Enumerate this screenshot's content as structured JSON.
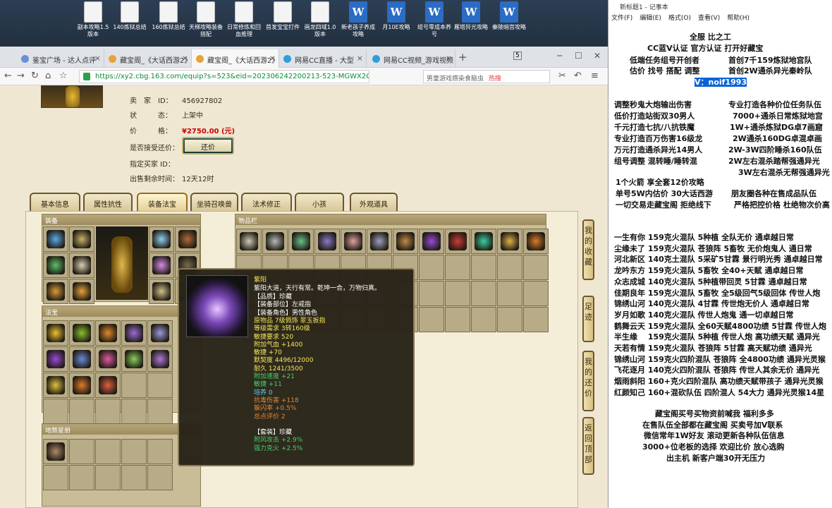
{
  "desktop": {
    "icons": [
      {
        "label": "副本攻略1.5版本",
        "type": "doc"
      },
      {
        "label": "140炼狱总结",
        "type": "doc"
      },
      {
        "label": "160炼狱总结",
        "type": "doc"
      },
      {
        "label": "天梯攻略装备搭配",
        "type": "doc"
      },
      {
        "label": "日常修炼和回血推理",
        "type": "doc"
      },
      {
        "label": "首发宝宝打件",
        "type": "doc"
      },
      {
        "label": "画龙四域1.0版本",
        "type": "doc"
      },
      {
        "label": "新老孩子养成攻略",
        "type": "word"
      },
      {
        "label": "月10E攻略",
        "type": "word"
      },
      {
        "label": "组号零成本养号",
        "type": "word"
      },
      {
        "label": "雁塔异光攻略",
        "type": "word"
      },
      {
        "label": "秦陵暗宫攻略",
        "type": "word"
      }
    ]
  },
  "browser": {
    "tabs": [
      {
        "label": "鉴宝广场 - 达人点评",
        "color": "#6a8fd8"
      },
      {
        "label": "藏宝阁_《大话西游2》",
        "color": "#e6a33a"
      },
      {
        "label": "藏宝阁_《大话西游2》",
        "color": "#e6a33a"
      },
      {
        "label": "网易CC直播 - 大型",
        "color": "#2d9ed8"
      },
      {
        "label": "网易CC视频_游戏视频",
        "color": "#2d9ed8"
      }
    ],
    "new_tab": "+",
    "tab_count": "5",
    "url": "https://xy2.cbg.163.com/equip?s=523&eid=202306242200213-523-MGWX2G7D1",
    "search_placeholder": "男童游戏感染食脑虫",
    "hot_label": "热搜",
    "nav": {
      "back": "←",
      "forward": "→",
      "refresh": "↻",
      "home": "⌂",
      "star": "☆",
      "cut": "✂",
      "undo": "↶",
      "menu": "≡",
      "minimize": "─",
      "maximize": "☐",
      "close": "✕"
    }
  },
  "listing": {
    "seller_label": "卖　家　ID：",
    "seller_id": "456927802",
    "status_label": "状　　　态：",
    "status": "上架中",
    "price_label": "价　　　格：",
    "price": "¥2750.00 (元)",
    "counter_label": "是否接受还价：",
    "counter_button": "还价",
    "buyer_label": "指定买家 ID：",
    "buyer": "",
    "remain_label": "出售剩余时间：",
    "remain": "12天12时"
  },
  "detail_tabs": [
    "基本信息",
    "属性抗性",
    "装备法宝",
    "坐骑召唤兽",
    "法术修正",
    "小孩",
    "外观道具"
  ],
  "active_tab": "装备法宝",
  "sections": {
    "equip": "装备",
    "items": "物品栏",
    "fabao": "法宝",
    "constellation": "地煞星册"
  },
  "side_buttons": [
    "我的收藏",
    "足迹",
    "我的还价",
    "返回顶部"
  ],
  "tooltip": {
    "name": "紫阳",
    "desc": "紫阳大道，天行有常。乾坤一合，万物归真。",
    "lines": [
      {
        "t": "【品质】珍藏",
        "c": "wh"
      },
      {
        "t": "【装备部位】左戒指",
        "c": "wh"
      },
      {
        "t": "【装备角色】男性角色",
        "c": "wh"
      },
      {
        "t": "原物品 7级佩饰 翠玉扳指",
        "c": "yl"
      },
      {
        "t": "等级需求 3转160级",
        "c": "yl"
      },
      {
        "t": "敏捷要求 520",
        "c": "yl"
      },
      {
        "t": "附加气血 +1400",
        "c": "yl"
      },
      {
        "t": "敏捷 +70",
        "c": "yl"
      },
      {
        "t": "默契度 4496/12000",
        "c": "yl"
      },
      {
        "t": "耐久 1241/3500",
        "c": "yl"
      },
      {
        "t": "附加速度 +21",
        "c": "gr"
      },
      {
        "t": "敏捷 +11",
        "c": "gr"
      },
      {
        "t": "培养 0",
        "c": "cy"
      },
      {
        "t": "抗毒伤害 +118",
        "c": "or"
      },
      {
        "t": "躲闪率 +0.5%",
        "c": "or"
      },
      {
        "t": "总点评价  2",
        "c": "or"
      },
      {
        "t": "",
        "c": "wh"
      },
      {
        "t": "【套装】珍藏",
        "c": "wh"
      },
      {
        "t": "附风攻击 +2.9%",
        "c": "gr"
      },
      {
        "t": "强力克火 +2.5%",
        "c": "gr"
      }
    ]
  },
  "notepad": {
    "title": "新标题1 - 记事本",
    "menu": [
      "文件(F)",
      "编辑(E)",
      "格式(O)",
      "查看(V)",
      "帮助(H)"
    ],
    "header": [
      "全服 比之工",
      "CC蓝V认证 官方认证 打开好藏宝",
      "低端任务组号开创者",
      "首创7千159炼狱地宫队",
      "估价 找号 搭配 调整",
      "首创2W通杀异光秦岭队"
    ],
    "contact": "V：noif1993",
    "left_col": [
      "调整秒鬼大炮输出伤害",
      "低价打造站街双30男人",
      "千元打造七抗/八抗铁魔",
      "专业打造百万伤害16级龙",
      "万元打造通杀异光14男人",
      "组号调整 混转睡/睡转混"
    ],
    "right_col": [
      "专业打造各种价位任务队伍",
      "7000+通杀日常炼狱地宫",
      "1W+通杀炼狱DG卓7画窟",
      "2W通杀160DG卓混卓画",
      "2W-3W四阶睡杀160队伍",
      "2W左右混杀踏帮强通异光",
      "3W左右混杀无帮强通异光"
    ],
    "mid": [
      "1个火箭 享全套12价攻略",
      "单号5W内估价 30大话西游",
      "朋友圈各种在售成品队伍",
      "一切交易走藏宝阁 拒绝线下",
      "严格把控价格 杜绝物次价高"
    ],
    "list": [
      "一生有你 159克火混队 5种植 全队无价 通卓越日常",
      "尘缘未了 159克火混队 苍狼阵 5畜牧 无价炮鬼人 通日常",
      "河北新区 140克土混队 5采矿5甘霖 景行明光秀 通卓越日常",
      "龙吟东方 159克火混队 5畜牧 全40+天赋 通卓越日常",
      "众志成城 140克火混队 5种植带回灵 5甘霖 通卓越日常",
      "佳期良年 159克火混队 5畜牧 全5级回气5级回体 传世人炮",
      "锦绣山河 140克火混队 4甘霖 传世炮无价人 通卓越日常",
      "岁月如歌 140克火混队 传世人炮鬼 通一切卓越日常",
      "鹤舞云天 159克火混队 全60天赋4800功绩 5甘霖 传世人炮",
      "半生缘　 159克火混队 5种植 传世人炮 高功绩天赋 通异光",
      "天若有情 159克火混队 苍狼阵 5甘霖 高天赋功绩 通异光",
      "锦绣山河 159克火四阶混队 苍狼阵 全4800功绩 通异光灵猴",
      "飞花逐月 140克火四阶混队 苍狼阵 传世人其余无价 通异光",
      "烟雨斜阳 160+克火四阶混队 高功绩天赋带孩子 通异光灵猴",
      "红颜知己 160+混砍队伍 四阶混人 54大力 通异光灵猴14星"
    ],
    "footer": [
      "藏宝阁买号买物资前喊我 福利多多",
      "在售队伍全部都在藏宝阁 买卖号加V联系",
      "微信常年1W好友 滚动更新各种队伍信息",
      "3000+位老板的选择 欢迎比价 放心选购",
      "出主机 新客户端30开无压力"
    ]
  }
}
